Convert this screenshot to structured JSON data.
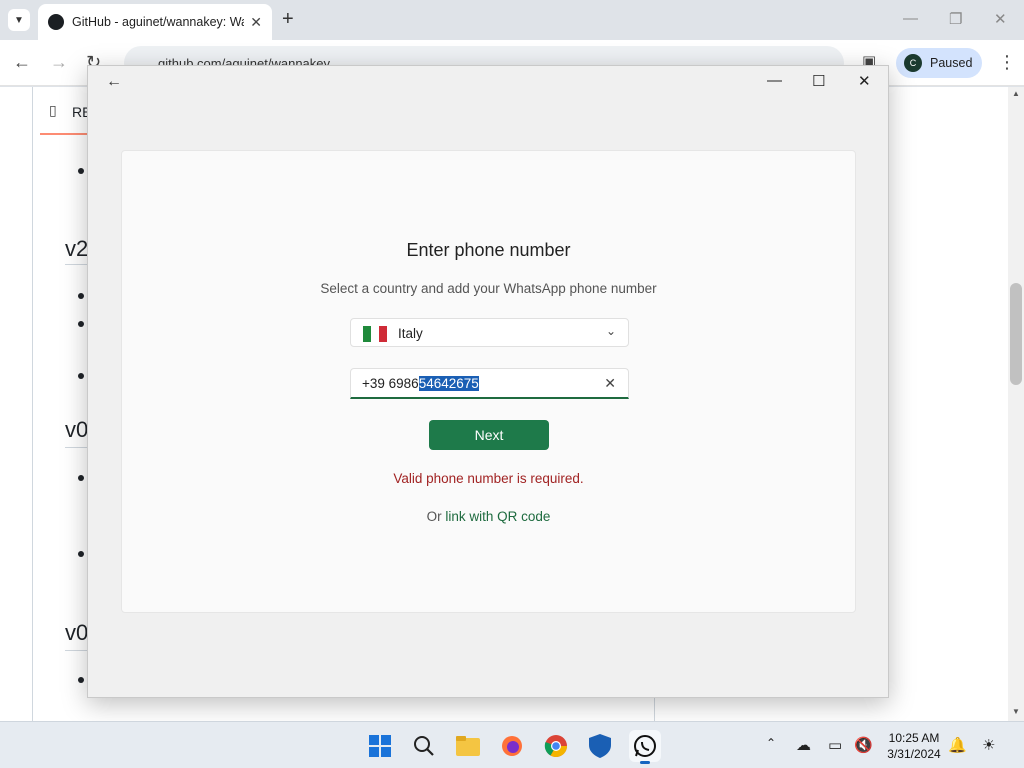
{
  "browser": {
    "tab_title": "GitHub - aguinet/wannakey: Wa",
    "url": "github.com/aguinet/wannakey",
    "profile_initial": "C",
    "profile_status": "Paused"
  },
  "github": {
    "readme_tab": "RE",
    "headings": [
      "v2",
      "v0",
      "v0"
    ]
  },
  "whatsapp": {
    "title": "Enter phone number",
    "subtitle": "Select a country and add your WhatsApp phone number",
    "country": "Italy",
    "phone_prefix": "+39 6986",
    "phone_selected": "54642675",
    "next_label": "Next",
    "error": "Valid phone number is required.",
    "qr_prefix": "Or",
    "qr_link": "link with QR code",
    "colors": {
      "primary": "#1e7a4a",
      "error": "#a12323",
      "link": "#1e6b3f"
    }
  },
  "taskbar": {
    "time": "10:25 AM",
    "date": "3/31/2024",
    "apps": [
      "windows-start",
      "search",
      "file-explorer",
      "firefox",
      "chrome",
      "defender",
      "whatsapp"
    ]
  }
}
